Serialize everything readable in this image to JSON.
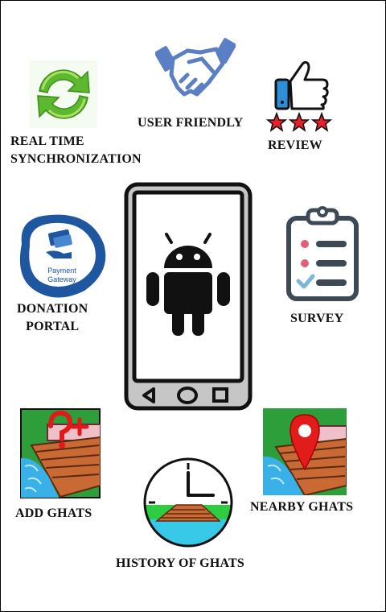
{
  "features": {
    "sync": {
      "label_line1": "REAL TIME",
      "label_line2": "SYNCHRONIZATION",
      "icon": "sync-arrows-icon",
      "colors": {
        "green": "#5cb82e",
        "light": "#a9e060"
      }
    },
    "friendly": {
      "label": "USER FRIENDLY",
      "icon": "handshake-icon",
      "colors": {
        "blue": "#5b7fc4"
      }
    },
    "review": {
      "label": "REVIEW",
      "icon": "thumbs-up-icon",
      "stars": 3,
      "colors": {
        "blue": "#2d8fd8",
        "star": "#e8202a"
      }
    },
    "donation": {
      "label_line1": "DONATION",
      "label_line2": "PORTAL",
      "icon": "payment-gateway-icon",
      "logo_text_line1": "Payment",
      "logo_text_line2": "Gateway",
      "colors": {
        "blue": "#1e56a0"
      }
    },
    "survey": {
      "label": "SURVEY",
      "icon": "clipboard-checklist-icon",
      "colors": {
        "dark": "#3d4a55",
        "red": "#e0607a",
        "blue": "#7ab8d8"
      }
    },
    "add_ghats": {
      "label": "ADD GHATS",
      "icon": "ghat-add-icon",
      "colors": {
        "red": "#e01a1a",
        "green": "#2e9e3a",
        "water": "#3ab0e8"
      }
    },
    "nearby_ghats": {
      "label": "NEARBY GHATS",
      "icon": "ghat-location-pin-icon",
      "colors": {
        "pin": "#e21b1b"
      }
    },
    "history": {
      "label": "HISTORY OF GHATS",
      "icon": "ghat-clock-icon",
      "colors": {
        "green": "#2ecc40",
        "water": "#38c8e8"
      }
    }
  },
  "center": {
    "icon": "android-phone-icon",
    "colors": {
      "android": "#111111"
    }
  }
}
